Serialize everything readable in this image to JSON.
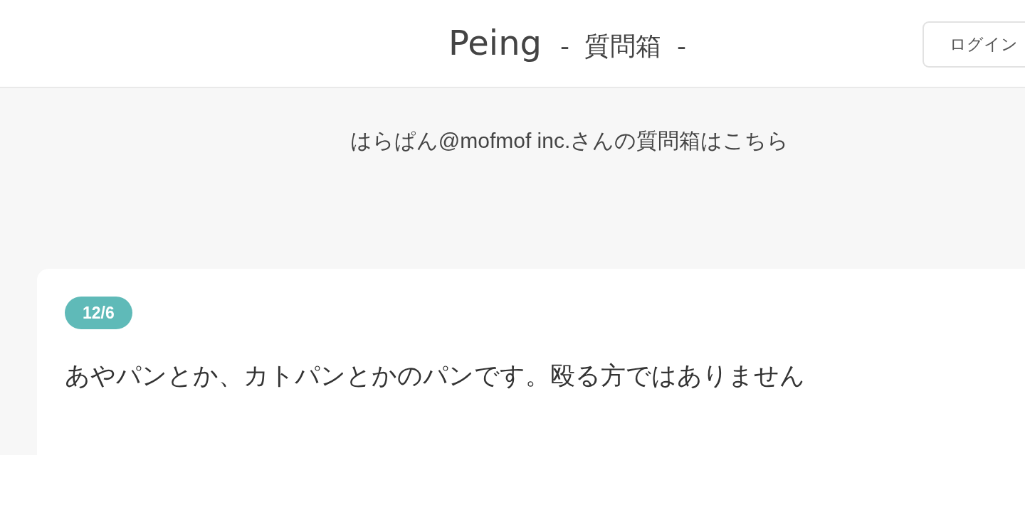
{
  "header": {
    "logo": "Peing",
    "tagline": "- 質問箱 -",
    "login_button": "ログイン"
  },
  "owner_line": "はらぱん@mofmof inc.さんの質問箱はこちら",
  "question": {
    "date": "12/6",
    "text": "あやパンとか、カトパンとかのパンです。殴る方ではありません"
  }
}
